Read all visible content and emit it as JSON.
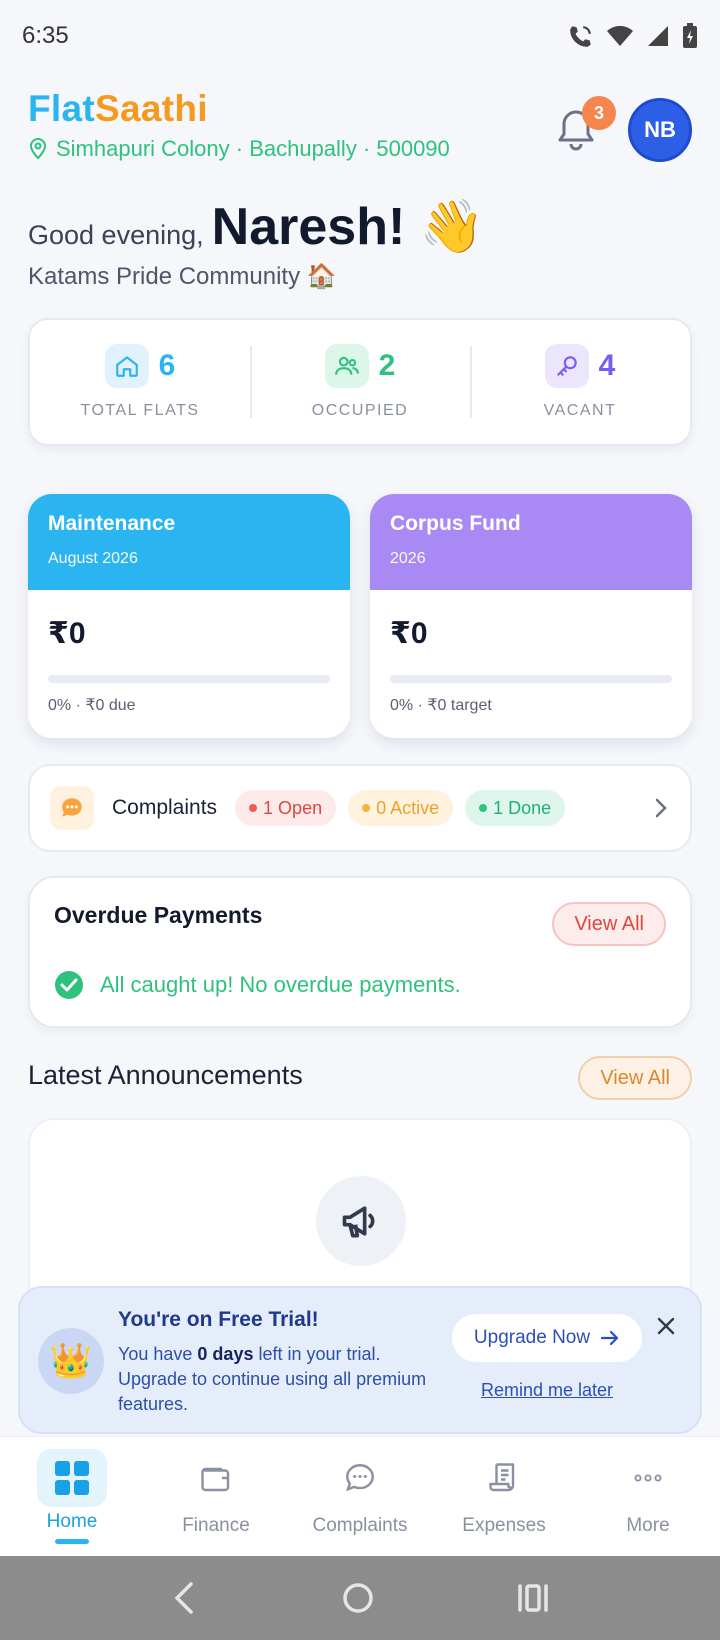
{
  "status": {
    "time": "6:35"
  },
  "header": {
    "brand_part1": "Flat",
    "brand_part2": "Saathi",
    "location": "Simhapuri Colony · Bachupally · 500090",
    "notification_count": "3",
    "avatar_initials": "NB"
  },
  "greeting": {
    "prefix": "Good evening,",
    "name": "Naresh! 👋",
    "community": "Katams Pride Community 🏠"
  },
  "stats": [
    {
      "value": "6",
      "label": "TOTAL FLATS",
      "color": "#2bb5f0"
    },
    {
      "value": "2",
      "label": "OCCUPIED",
      "color": "#2ec27e"
    },
    {
      "value": "4",
      "label": "VACANT",
      "color": "#7b5cf0"
    }
  ],
  "maintenance": {
    "title": "Maintenance",
    "period": "August 2026",
    "amount": "₹0",
    "meta": "0% · ₹0 due",
    "progress_percent": 0,
    "color": "#2bb5f0"
  },
  "corpus": {
    "title": "Corpus Fund",
    "period": "2026",
    "amount": "₹0",
    "meta": "0% · ₹0 target",
    "progress_percent": 0,
    "color": "#a98af5"
  },
  "complaints": {
    "title": "Complaints",
    "open": "1 Open",
    "active": "0 Active",
    "done": "1 Done"
  },
  "overdue": {
    "title": "Overdue Payments",
    "view_all": "View All",
    "message": "All caught up! No overdue payments."
  },
  "announcements": {
    "title": "Latest Announcements",
    "view_all": "View All"
  },
  "trial": {
    "title": "You're on Free Trial!",
    "desc_before": "You have ",
    "desc_days": "0 days",
    "desc_after": " left in your trial. Upgrade to continue using all premium features.",
    "upgrade_label": "Upgrade Now",
    "remind_label": "Remind me later"
  },
  "nav": {
    "home": "Home",
    "finance": "Finance",
    "complaints": "Complaints",
    "expenses": "Expenses",
    "more": "More"
  }
}
